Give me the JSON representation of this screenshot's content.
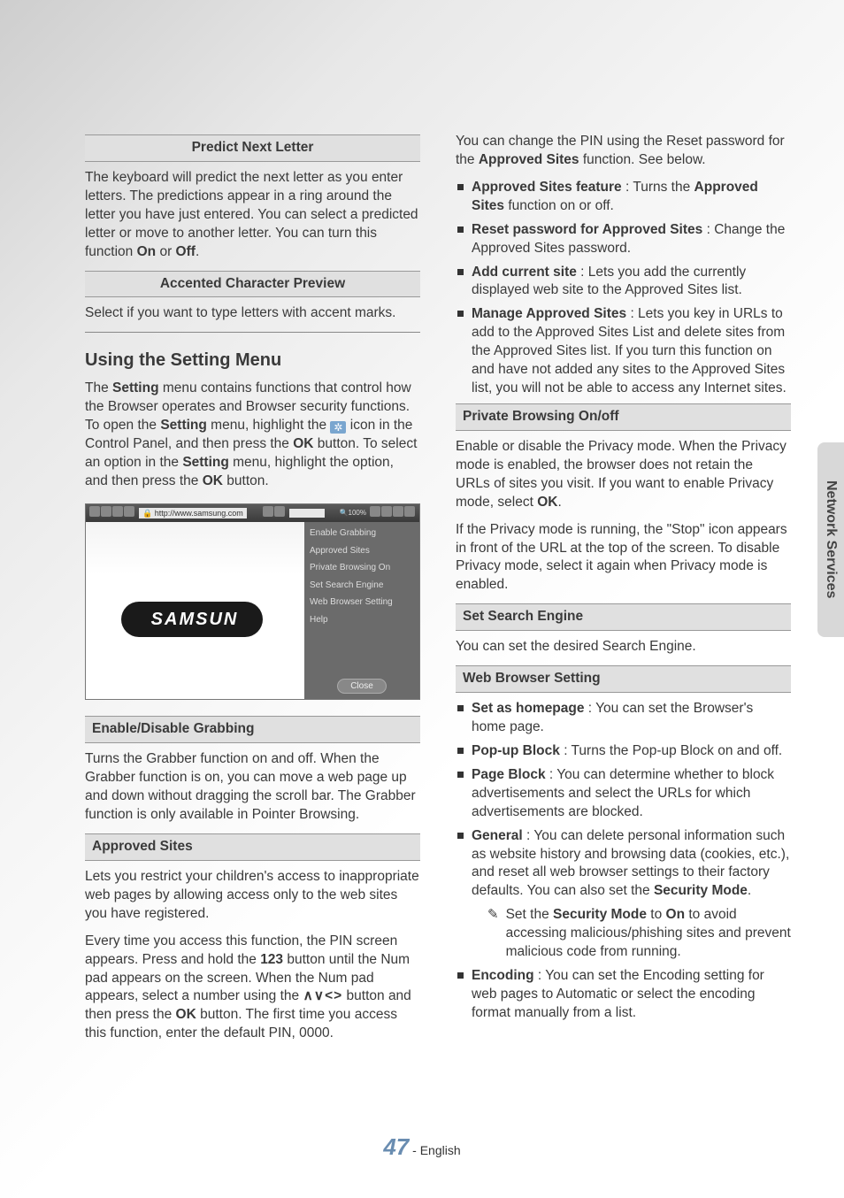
{
  "side_tab": "Network Services",
  "page_number": "47",
  "page_lang": "English",
  "col1": {
    "sec_predict_title": "Predict Next Letter",
    "predict_body": "The keyboard will predict the next letter as you enter letters. The predictions appear in a ring around the letter you have just entered. You can select a predicted letter or move to another letter. You can turn this function ",
    "on": "On",
    "or": " or ",
    "off": "Off",
    "period": ".",
    "sec_accent_title": "Accented Character Preview",
    "accent_body": "Select if you want to type letters with accent marks.",
    "heading_setting": "Using the Setting Menu",
    "setting_p1a": "The ",
    "setting_word": "Setting",
    "setting_p1b": " menu contains functions that control how the Browser operates and Browser security functions. To open the ",
    "setting_p1c": " menu, highlight the ",
    "setting_p1d": " icon in the Control Panel, and then press the ",
    "ok_word": "OK",
    "setting_p1e": " button. To select an option in the ",
    "setting_p1f": " menu, highlight the option, and then press the ",
    "setting_p1g": " button.",
    "browser": {
      "url": "http://www.samsung.com",
      "zoom": "100%",
      "logo": "SAMSUN",
      "menu": {
        "i1": "Enable Grabbing",
        "i2": "Approved Sites",
        "i3": "Private Browsing On",
        "i4": "Set Search Engine",
        "i5": "Web Browser Setting",
        "i6": "Help",
        "close": "Close"
      }
    },
    "sec_grab_title": "Enable/Disable Grabbing",
    "grab_body": "Turns the Grabber function on and off. When the Grabber function is on, you can move a web page up and down without dragging the scroll bar. The Grabber function is only available in Pointer Browsing.",
    "sec_approved_title": "Approved Sites",
    "approved_p1": "Lets you restrict your children's access to inappropriate web pages by allowing access only to the web sites you have registered.",
    "approved_p2a": "Every time you access this function, the PIN screen appears. Press and hold the ",
    "b123": "123",
    "approved_p2b": " button until the Num pad appears on the screen. When the Num pad appears, select a number using the ",
    "arrows": "∧∨<>",
    "approved_p2c": " button and then press the ",
    "approved_p2d": " button. The first time you access this function, enter the default PIN, 0000."
  },
  "col2": {
    "pin_p1a": "You can change the PIN using the Reset password for the ",
    "approved_sites_word": "Approved Sites",
    "pin_p1b": " function. See below.",
    "li1a": "Approved Sites feature",
    "li1b": " : Turns the ",
    "li1c": " function on or off.",
    "li2a": "Reset password for Approved Sites",
    "li2b": " : Change the Approved Sites password.",
    "li3a": "Add current site",
    "li3b": " : Lets you add the currently displayed web site to the Approved Sites list.",
    "li4a": "Manage Approved Sites",
    "li4b": " : Lets you key in URLs to add to the Approved Sites List and delete sites from the Approved Sites list. If you turn this function on and have not added any sites to the Approved Sites list, you will not be able to access any Internet sites.",
    "sec_private_title": "Private Browsing On/off",
    "private_p1a": "Enable or disable the Privacy mode. When the Privacy mode is enabled, the browser does not retain the URLs of sites you visit. If you want to enable Privacy mode, select ",
    "private_p1b": ".",
    "private_p2": "If the Privacy mode is running, the \"Stop\" icon appears in front of the URL at the top of the screen. To disable Privacy mode, select it again when Privacy mode is enabled.",
    "sec_search_title": "Set Search Engine",
    "search_body": "You can set the desired Search Engine.",
    "sec_wbs_title": "Web Browser Setting",
    "wli1a": "Set as homepage",
    "wli1b": " : You can set the Browser's home page.",
    "wli2a": "Pop-up Block",
    "wli2b": " : Turns the Pop-up Block on and off.",
    "wli3a": "Page Block",
    "wli3b": " : You can determine whether to block advertisements and select the URLs for which advertisements are blocked.",
    "wli4a": "General",
    "wli4b": " : You can delete personal information such as website history and browsing data (cookies, etc.), and reset all web browser settings to their factory defaults. You can also set the ",
    "security_mode": "Security Mode",
    "wli4c": ".",
    "note1a": "Set the ",
    "note1b": " to ",
    "on": "On",
    "note1c": " to avoid accessing malicious/phishing sites and prevent malicious code from running.",
    "wli5a": "Encoding",
    "wli5b": " : You can set the Encoding setting for web pages to Automatic or select the encoding format manually from a list."
  }
}
